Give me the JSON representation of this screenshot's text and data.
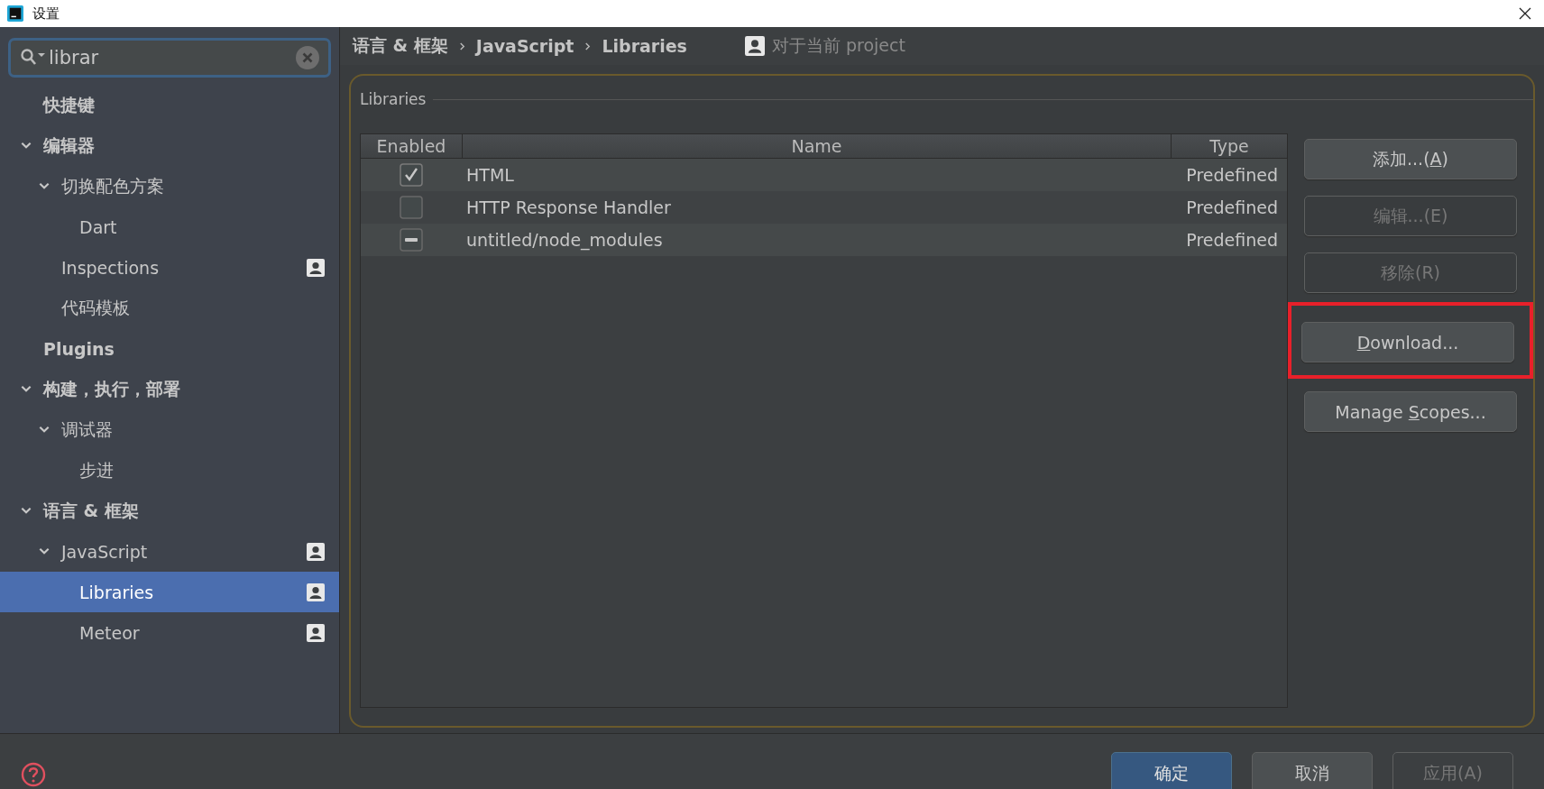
{
  "window": {
    "title": "设置"
  },
  "search": {
    "value": "librar"
  },
  "sidebar": {
    "items": [
      {
        "label": "快捷键",
        "bold": true,
        "selected": false
      },
      {
        "label": "编辑器",
        "bold": true,
        "selected": false,
        "expanded": true,
        "children": [
          {
            "label": "切换配色方案",
            "bold": false,
            "selected": false,
            "expanded": true,
            "children": [
              {
                "label": "Dart",
                "bold": false,
                "selected": false
              }
            ]
          },
          {
            "label": "Inspections",
            "bold": false,
            "selected": false,
            "project_scope": true
          },
          {
            "label": "代码模板",
            "bold": false,
            "selected": false
          }
        ]
      },
      {
        "label": "Plugins",
        "bold": true,
        "selected": false
      },
      {
        "label": "构建，执行，部署",
        "bold": true,
        "selected": false,
        "expanded": true,
        "children": [
          {
            "label": "调试器",
            "bold": false,
            "selected": false,
            "expanded": true,
            "children": [
              {
                "label": "步进",
                "bold": false,
                "selected": false
              }
            ]
          }
        ]
      },
      {
        "label": "语言 & 框架",
        "bold": true,
        "selected": false,
        "expanded": true,
        "children": [
          {
            "label": "JavaScript",
            "bold": false,
            "selected": false,
            "expanded": true,
            "project_scope": true,
            "children": [
              {
                "label": "Libraries",
                "bold": false,
                "selected": true,
                "project_scope": true
              },
              {
                "label": "Meteor",
                "bold": false,
                "selected": false,
                "project_scope": true
              }
            ]
          }
        ]
      }
    ]
  },
  "breadcrumb": [
    "语言 & 框架",
    "JavaScript",
    "Libraries"
  ],
  "scope_note": "对于当前 project",
  "panel": {
    "title": "Libraries",
    "table": {
      "columns": [
        "Enabled",
        "Name",
        "Type"
      ],
      "rows": [
        {
          "checked": true,
          "mixed": false,
          "name": "HTML",
          "type": "Predefined"
        },
        {
          "checked": false,
          "mixed": false,
          "name": "HTTP Response Handler",
          "type": "Predefined"
        },
        {
          "checked": false,
          "mixed": true,
          "name": "untitled/node_modules",
          "type": "Predefined"
        }
      ]
    },
    "buttons": [
      {
        "pre": "添加...(",
        "key": "A",
        "post": ")",
        "disabled": false,
        "highlighted": false
      },
      {
        "pre": "编辑...(E)",
        "disabled": true,
        "highlighted": false
      },
      {
        "pre": "移除(R)",
        "disabled": true,
        "highlighted": false
      },
      {
        "key": "D",
        "post": "ownload...",
        "disabled": false,
        "highlighted": true
      },
      {
        "pre": "Manage ",
        "key": "S",
        "post": "copes...",
        "disabled": false,
        "highlighted": false
      }
    ]
  },
  "footer": {
    "buttons": [
      {
        "label": "确定",
        "primary": true,
        "disabled": false
      },
      {
        "label": "取消",
        "primary": false,
        "disabled": false
      },
      {
        "label": "应用(A)",
        "primary": false,
        "disabled": true
      }
    ]
  }
}
